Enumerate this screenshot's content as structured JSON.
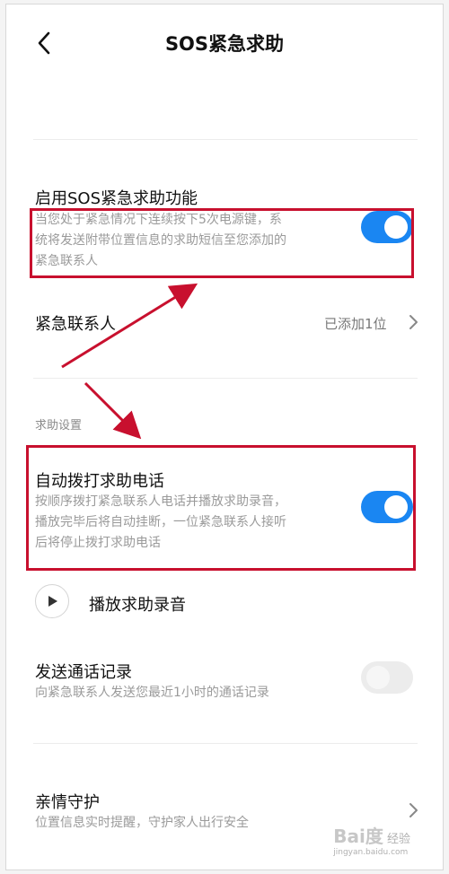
{
  "header": {
    "title": "SOS紧急求助"
  },
  "sos": {
    "title": "启用SOS紧急求助功能",
    "desc_lines": [
      "当您处于紧急情况下连续按下5次电源键，系",
      "统将发送附带位置信息的求助短信至您添加的",
      "紧急联系人"
    ],
    "enabled": true
  },
  "contacts": {
    "title": "紧急联系人",
    "value": "已添加1位"
  },
  "help_settings": {
    "section_label": "求助设置",
    "auto_call": {
      "title": "自动拨打求助电话",
      "desc_lines": [
        "按顺序拨打紧急联系人电话并播放求助录音，",
        "播放完毕后将自动挂断，一位紧急联系人接听",
        "后将停止拨打求助电话"
      ],
      "enabled": true
    },
    "play_recording": {
      "label": "播放求助录音"
    },
    "send_log": {
      "title": "发送通话记录",
      "desc": "向紧急联系人发送您最近1小时的通话记录",
      "enabled": false
    }
  },
  "family": {
    "title": "亲情守护",
    "desc": "位置信息实时提醒，守护家人出行安全"
  },
  "colors": {
    "accent": "#1a86f2",
    "annotation": "#c8102e"
  },
  "watermark": {
    "logo": "Bai度",
    "text": "经验",
    "url": "jingyan.baidu.com"
  }
}
